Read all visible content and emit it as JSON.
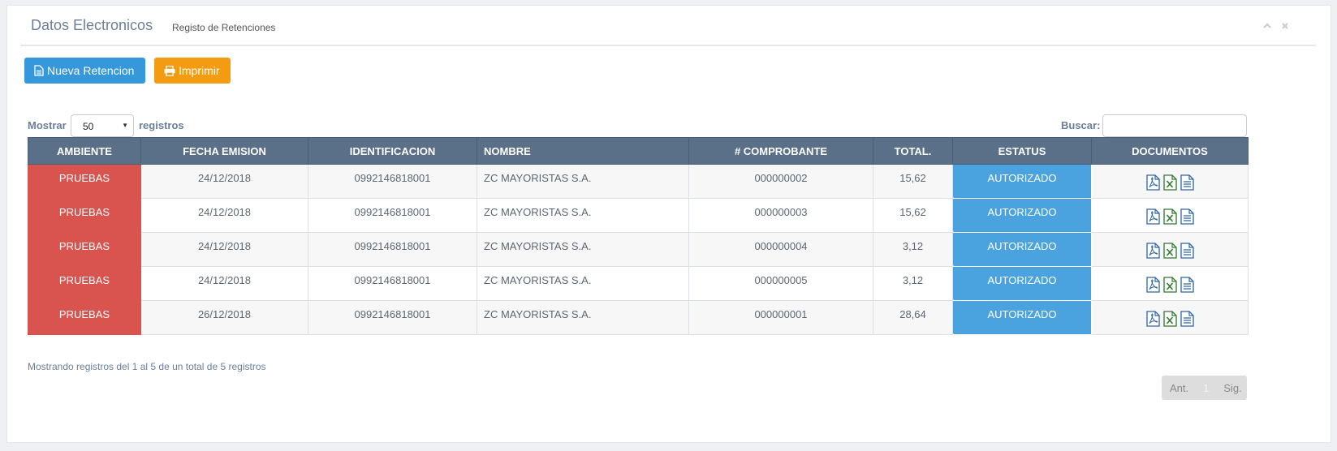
{
  "panel": {
    "title": "Datos Electronicos",
    "subtitle": "Registo de Retenciones"
  },
  "toolbar": {
    "new_label": "Nueva Retencion",
    "print_label": "Imprimir"
  },
  "length": {
    "prefix": "Mostrar",
    "value": "50",
    "suffix": "registros"
  },
  "search": {
    "label": "Buscar:",
    "value": ""
  },
  "table": {
    "headers": [
      "AMBIENTE",
      "FECHA EMISION",
      "IDENTIFICACION",
      "NOMBRE",
      "# COMPROBANTE",
      "TOTAL.",
      "ESTATUS",
      "DOCUMENTOS"
    ],
    "rows": [
      [
        "PRUEBAS",
        "24/12/2018",
        "0992146818001",
        "ZC MAYORISTAS S.A.",
        "000000002",
        "15,62",
        "AUTORIZADO"
      ],
      [
        "PRUEBAS",
        "24/12/2018",
        "0992146818001",
        "ZC MAYORISTAS S.A.",
        "000000003",
        "15,62",
        "AUTORIZADO"
      ],
      [
        "PRUEBAS",
        "24/12/2018",
        "0992146818001",
        "ZC MAYORISTAS S.A.",
        "000000004",
        "3,12",
        "AUTORIZADO"
      ],
      [
        "PRUEBAS",
        "24/12/2018",
        "0992146818001",
        "ZC MAYORISTAS S.A.",
        "000000005",
        "3,12",
        "AUTORIZADO"
      ],
      [
        "PRUEBAS",
        "26/12/2018",
        "0992146818001",
        "ZC MAYORISTAS S.A.",
        "000000001",
        "28,64",
        "AUTORIZADO"
      ]
    ],
    "doc_icons": [
      "pdf-icon",
      "excel-icon",
      "xml-document-icon"
    ]
  },
  "info_text": "Mostrando registros del 1 al 5 de un total de 5 registros",
  "pager": {
    "prev": "Ant.",
    "current": "1",
    "next": "Sig."
  },
  "colors": {
    "header_bg": "#5a7089",
    "ambiente_bg": "#d9534f",
    "estatus_bg": "#4aa3df",
    "new_button": "#3498db",
    "print_button": "#f39c12"
  }
}
